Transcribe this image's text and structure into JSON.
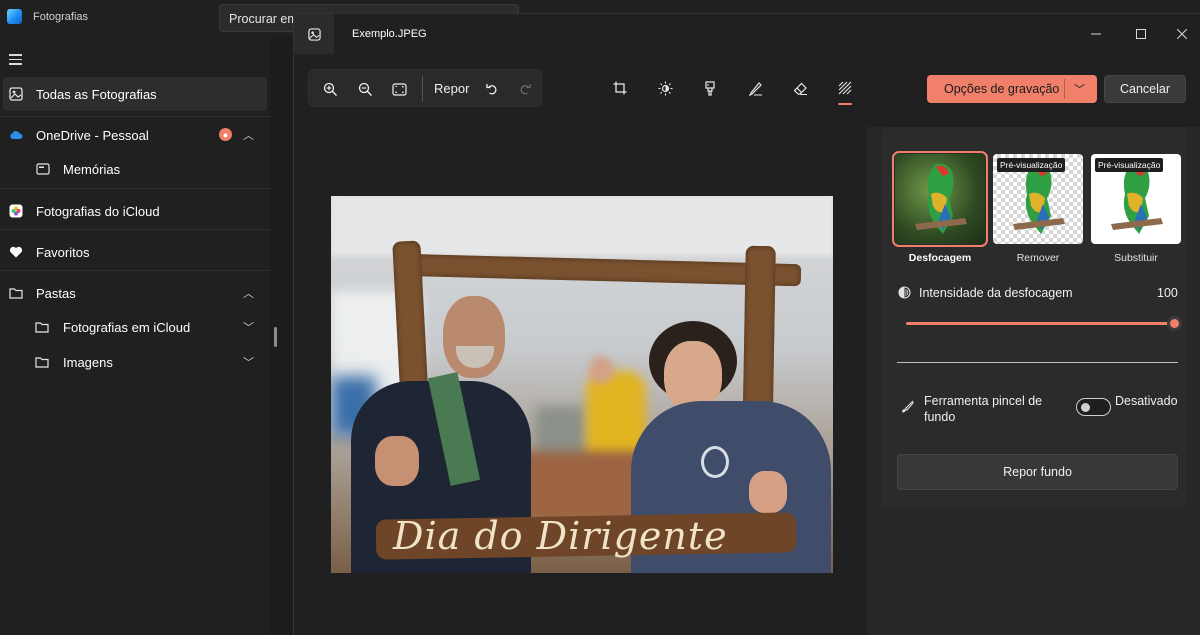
{
  "app": {
    "title": "Fotografias",
    "search_text": "Procurar em Todas as Fotografias"
  },
  "sidebar": {
    "items": [
      {
        "label": "Todas as Fotografias",
        "icon": "photo-gallery-icon"
      },
      {
        "label": "OneDrive - Pessoal",
        "icon": "cloud-icon"
      },
      {
        "label": "Memórias",
        "icon": "memories-icon"
      },
      {
        "label": "Fotografias do iCloud",
        "icon": "icloud-photos-icon"
      },
      {
        "label": "Favoritos",
        "icon": "heart-icon"
      },
      {
        "label": "Pastas",
        "icon": "folder-icon"
      },
      {
        "label": "Fotografias em iCloud",
        "icon": "folder-icon"
      },
      {
        "label": "Imagens",
        "icon": "folder-icon"
      }
    ]
  },
  "editor": {
    "file_name": "Exemplo.JPEG",
    "reset_label": "Repor",
    "tools": [
      "crop-icon",
      "brightness-icon",
      "filter-icon",
      "markup-icon",
      "erase-icon",
      "background-icon"
    ],
    "save_label": "Opções de gravação",
    "cancel_label": "Cancelar",
    "photo_caption": "Dia do Dirigente"
  },
  "panel": {
    "options": [
      {
        "label": "Desfocagem",
        "tag": ""
      },
      {
        "label": "Remover",
        "tag": "Pré-visualização"
      },
      {
        "label": "Substituir",
        "tag": "Pré-visualização"
      }
    ],
    "intensity_label": "Intensidade da desfocagem",
    "intensity_value": "100",
    "intensity_level": 1.0,
    "brush_label": "Ferramenta pincel de fundo",
    "toggle_label": "Desativado",
    "reset_bg_label": "Repor fundo"
  },
  "colors": {
    "accent": "#f0806a",
    "background": "#202020"
  }
}
